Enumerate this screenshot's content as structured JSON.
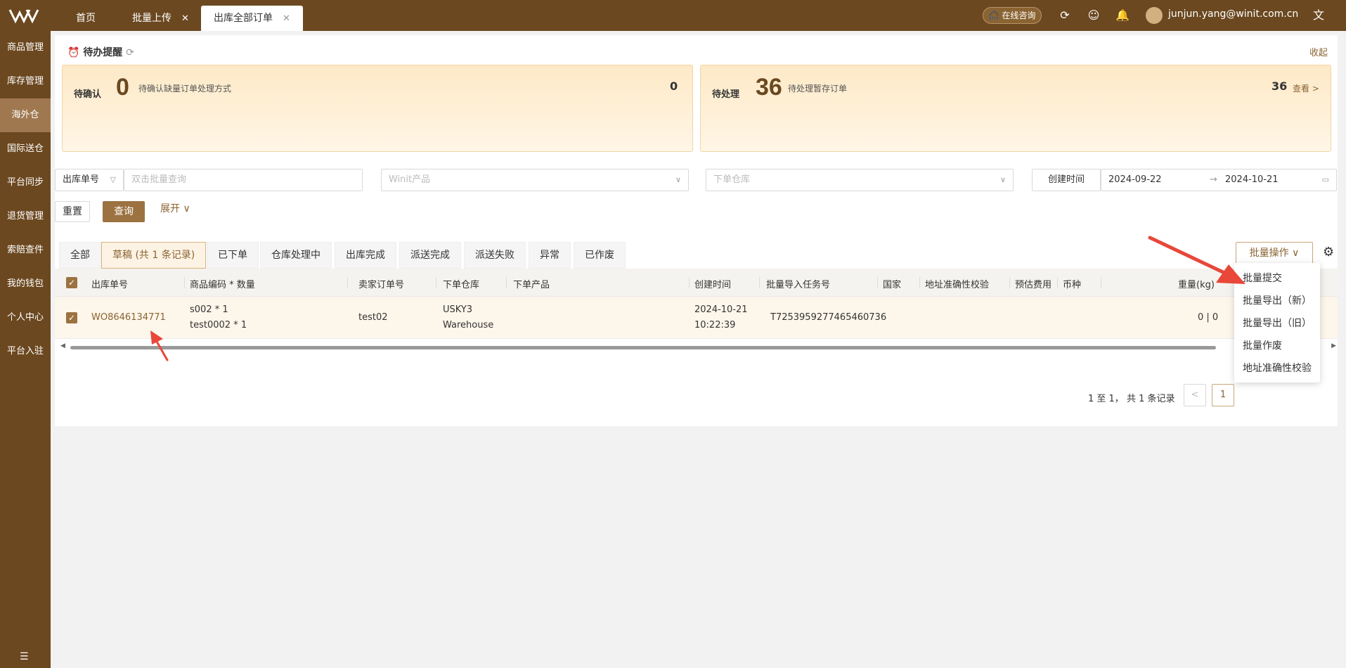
{
  "topbar": {
    "tabs": [
      {
        "label": "首页",
        "closable": false
      },
      {
        "label": "批量上传",
        "closable": true
      },
      {
        "label": "出库全部订单",
        "closable": true,
        "active": true
      }
    ],
    "consult_label": "在线咨询",
    "user_email": "junjun.yang@winit.com.cn"
  },
  "sidebar": {
    "items": [
      "商品管理",
      "库存管理",
      "海外仓",
      "国际送仓",
      "平台同步",
      "退货管理",
      "索赔查件",
      "我的钱包",
      "个人中心",
      "平台入驻"
    ],
    "active_index": 2
  },
  "todo": {
    "title": "待办提醒",
    "collapse_label": "收起",
    "confirm": {
      "label": "待确认",
      "number": "0",
      "desc": "待确认缺量订单处理方式",
      "count": "0"
    },
    "pending": {
      "label": "待处理",
      "number": "36",
      "desc": "待处理暂存订单",
      "count": "36",
      "view_label": "查看 >"
    }
  },
  "filter": {
    "field_select": "出库单号",
    "search_placeholder": "双击批量查询",
    "product_placeholder": "Winit产品",
    "warehouse_placeholder": "下单仓库",
    "date_label": "创建时间",
    "date_start": "2024-09-22",
    "date_end": "2024-10-21",
    "reset_label": "重置",
    "query_label": "查询",
    "expand_label": "展开"
  },
  "status_tabs": [
    "全部",
    "草稿 (共 1 条记录)",
    "已下单",
    "仓库处理中",
    "出库完成",
    "派送完成",
    "派送失败",
    "异常",
    "已作废"
  ],
  "batch_button": "批量操作",
  "table": {
    "columns": [
      "出库单号",
      "商品编码 * 数量",
      "卖家订单号",
      "下单仓库",
      "下单产品",
      "创建时间",
      "批量导入任务号",
      "国家",
      "地址准确性校验",
      "预估费用",
      "币种",
      "重量(kg)"
    ],
    "row": {
      "order_no": "WO8646134771",
      "sku_line1": "s002 * 1",
      "sku_line2": "test0002 * 1",
      "seller_order": "test02",
      "warehouse_line1": "USKY3",
      "warehouse_line2": "Warehouse",
      "created_date": "2024-10-21",
      "created_time": "10:22:39",
      "task_no": "T7253959277465460736",
      "weight": "0 | 0"
    }
  },
  "pager": {
    "summary": "1 至 1， 共 1 条记录",
    "current": "1"
  },
  "dropdown": [
    "批量提交",
    "批量导出（新）",
    "批量导出（旧）",
    "批量作废",
    "地址准确性校验"
  ],
  "colors": {
    "brand": "#6b4820",
    "accent": "#9b7240",
    "arrow": "#e8473a"
  }
}
